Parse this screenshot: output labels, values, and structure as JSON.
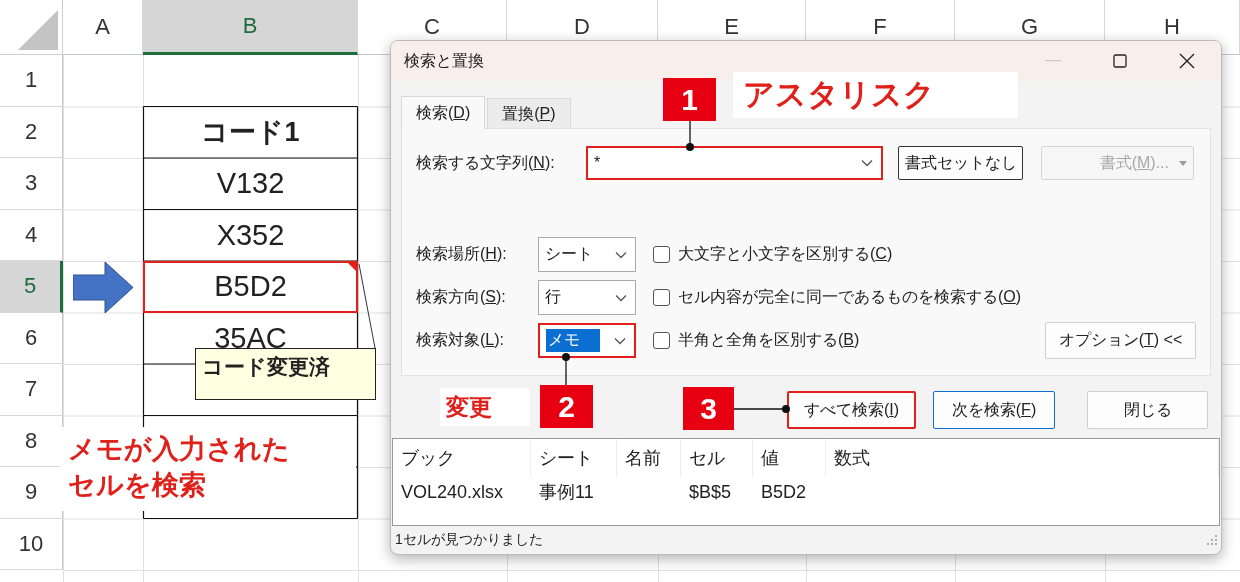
{
  "sheet": {
    "columns": [
      {
        "label": "A",
        "selected": false
      },
      {
        "label": "B",
        "selected": true
      },
      {
        "label": "C",
        "selected": false
      },
      {
        "label": "D",
        "selected": false
      },
      {
        "label": "E",
        "selected": false
      },
      {
        "label": "F",
        "selected": false
      },
      {
        "label": "G",
        "selected": false
      },
      {
        "label": "H",
        "selected": false
      }
    ],
    "rows": [
      {
        "number": "1",
        "selected": false,
        "in_table": false
      },
      {
        "number": "2",
        "selected": false,
        "in_table": true,
        "b": {
          "text": "コード1",
          "bold": true,
          "annotated": false
        }
      },
      {
        "number": "3",
        "selected": false,
        "in_table": true,
        "b": {
          "text": "V132",
          "bold": false,
          "annotated": false
        }
      },
      {
        "number": "4",
        "selected": false,
        "in_table": true,
        "b": {
          "text": "X352",
          "bold": false,
          "annotated": false
        }
      },
      {
        "number": "5",
        "selected": true,
        "in_table": true,
        "b": {
          "text": "B5D2",
          "bold": false,
          "annotated": true
        }
      },
      {
        "number": "6",
        "selected": false,
        "in_table": true,
        "b": {
          "text": "35AC",
          "bold": false,
          "annotated": false
        }
      },
      {
        "number": "7",
        "selected": false,
        "in_table": true
      },
      {
        "number": "8",
        "selected": false,
        "in_table": true
      },
      {
        "number": "9",
        "selected": false,
        "in_table": true
      },
      {
        "number": "10",
        "selected": false,
        "in_table": false
      }
    ],
    "comment": {
      "text": "コード変更済"
    }
  },
  "dialog": {
    "title": "検索と置換",
    "tabs": [
      {
        "label": "検索(D)",
        "selected": true
      },
      {
        "label": "置換(P)",
        "selected": false
      }
    ],
    "find": {
      "label": "検索する文字列(N):",
      "value": "*",
      "annotated": true
    },
    "format_buttons": [
      {
        "label": "書式セットなし",
        "disabled": false
      },
      {
        "label": "書式(M)...",
        "disabled": true
      }
    ],
    "options": [
      {
        "label": "検索場所(H):",
        "value": "シート",
        "highlighted": false,
        "annotated": false
      },
      {
        "label": "検索方向(S):",
        "value": "行",
        "highlighted": false,
        "annotated": false
      },
      {
        "label": "検索対象(L):",
        "value": "メモ",
        "highlighted": true,
        "annotated": true
      }
    ],
    "checkboxes": [
      {
        "label": "大文字と小文字を区別する(C)",
        "checked": false
      },
      {
        "label": "セル内容が完全に同一であるものを検索する(O)",
        "checked": false
      },
      {
        "label": "半角と全角を区別する(B)",
        "checked": false
      }
    ],
    "options_button": "オプション(T) <<",
    "buttons": [
      {
        "label": "すべて検索(I)",
        "default": false,
        "annotated": true
      },
      {
        "label": "次を検索(F)",
        "default": true,
        "annotated": false
      },
      {
        "label": "閉じる",
        "default": false,
        "annotated": false
      }
    ],
    "results": {
      "columns": [
        "ブック",
        "シート",
        "名前",
        "セル",
        "値",
        "数式"
      ],
      "rows": [
        [
          "VOL240.xlsx",
          "事例11",
          null,
          "$B$5",
          "B5D2",
          null
        ]
      ]
    },
    "status": "1セルが見つかりました"
  },
  "callouts": [
    {
      "number": "1",
      "label": "アスタリスク"
    },
    {
      "number": "2",
      "label": "変更"
    },
    {
      "number": "3"
    }
  ],
  "note": {
    "lines": [
      "メモが入力された",
      "セルを検索"
    ]
  }
}
